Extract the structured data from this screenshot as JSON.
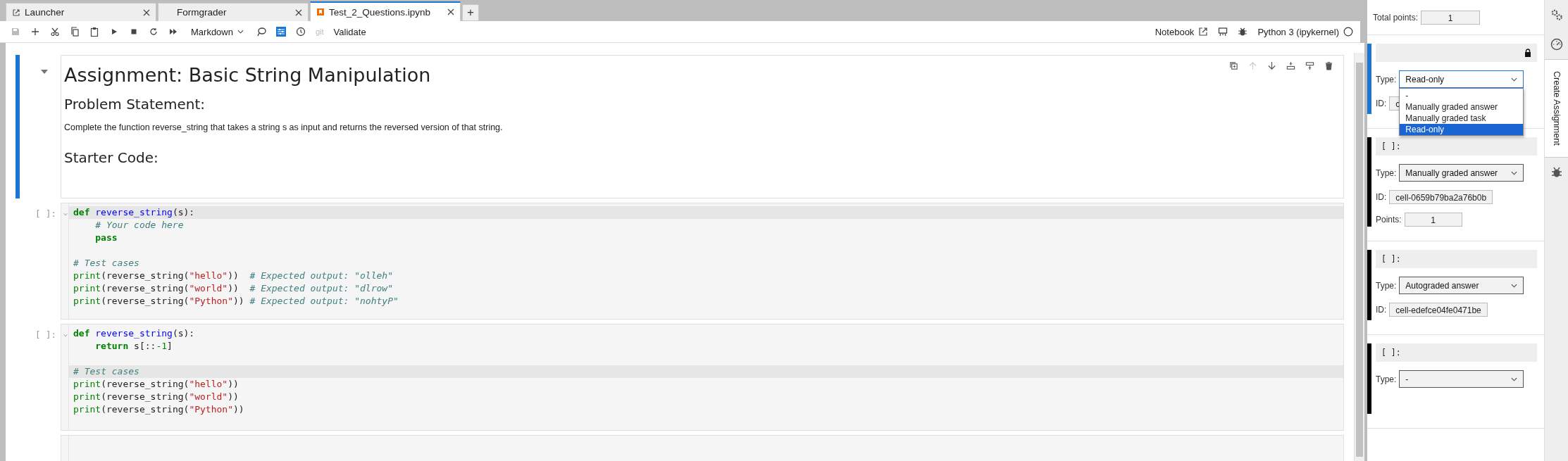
{
  "tabs": [
    {
      "label": "Launcher",
      "kind": "launcher",
      "selected": false
    },
    {
      "label": "Formgrader",
      "kind": "plain",
      "selected": false
    },
    {
      "label": "Test_2_Questions.ipynb",
      "kind": "notebook",
      "selected": true
    }
  ],
  "add_tab": "+",
  "toolbar": {
    "cell_type": "Markdown",
    "git": "git",
    "validate": "Validate",
    "notebook_link": "Notebook",
    "kernel": "Python 3 (ipykernel)"
  },
  "cells": [
    {
      "kind": "markdown",
      "selected": true,
      "blocks": [
        {
          "kind": "h1",
          "text": "Assignment: Basic String Manipulation"
        },
        {
          "kind": "h2",
          "text": "Problem Statement:"
        },
        {
          "kind": "p",
          "text": "Complete the function reverse_string that takes a string s as input and returns the reversed version of that string."
        },
        {
          "kind": "h2",
          "text": "Starter Code:"
        }
      ]
    },
    {
      "kind": "code",
      "selected": false,
      "prompt": "[ ]:",
      "lines": [
        {
          "highlighted": true,
          "indented": false,
          "tokens": [
            {
              "kind": "keyword",
              "text": "def"
            },
            {
              "kind": "def",
              "text": "reverse_string"
            },
            {
              "kind": "plain",
              "text": "(s):"
            }
          ]
        },
        {
          "highlighted": false,
          "indented": true,
          "tokens": [
            {
              "kind": "comment",
              "text": "# Your code here"
            }
          ]
        },
        {
          "highlighted": false,
          "indented": true,
          "tokens": [
            {
              "kind": "keyword",
              "text": "pass"
            }
          ]
        },
        {
          "highlighted": false
        },
        {
          "highlighted": false,
          "tokens": [
            {
              "kind": "comment",
              "text": "# Test cases"
            }
          ]
        },
        {
          "highlighted": false,
          "tokens": [
            {
              "kind": "builtin",
              "text": "print"
            },
            {
              "kind": "plain",
              "text": "(reverse_string("
            },
            {
              "kind": "string",
              "text": "\"hello\""
            },
            {
              "kind": "plain",
              "text": "))  "
            },
            {
              "kind": "comment",
              "text": "# Expected output: \"olleh\""
            }
          ]
        },
        {
          "highlighted": false,
          "tokens": [
            {
              "kind": "builtin",
              "text": "print"
            },
            {
              "kind": "plain",
              "text": "(reverse_string("
            },
            {
              "kind": "string",
              "text": "\"world\""
            },
            {
              "kind": "plain",
              "text": "))  "
            },
            {
              "kind": "comment",
              "text": "# Expected output: \"dlrow\""
            }
          ]
        },
        {
          "highlighted": false,
          "tokens": [
            {
              "kind": "builtin",
              "text": "print"
            },
            {
              "kind": "plain",
              "text": "(reverse_string("
            },
            {
              "kind": "string",
              "text": "\"Python\""
            },
            {
              "kind": "plain",
              "text": ")) "
            },
            {
              "kind": "comment",
              "text": "# Expected output: \"nohtyP\""
            }
          ]
        }
      ]
    },
    {
      "kind": "code",
      "selected": false,
      "prompt": "[ ]:",
      "lines": [
        {
          "highlighted": false,
          "indented": false,
          "tokens": [
            {
              "kind": "keyword",
              "text": "def"
            },
            {
              "kind": "def",
              "text": "reverse_string"
            },
            {
              "kind": "plain",
              "text": "(s):"
            }
          ]
        },
        {
          "highlighted": false,
          "indented": true,
          "tokens": [
            {
              "kind": "keyword",
              "text": "return"
            },
            {
              "kind": "plain",
              "text": " s[::"
            },
            {
              "kind": "number",
              "text": "-1"
            },
            {
              "kind": "plain",
              "text": "]"
            }
          ]
        },
        {
          "highlighted": false
        },
        {
          "highlighted": true,
          "tokens": [
            {
              "kind": "comment",
              "text": "# Test cases"
            }
          ]
        },
        {
          "highlighted": false,
          "tokens": [
            {
              "kind": "builtin",
              "text": "print"
            },
            {
              "kind": "plain",
              "text": "(reverse_string("
            },
            {
              "kind": "string",
              "text": "\"hello\""
            },
            {
              "kind": "plain",
              "text": "))"
            }
          ]
        },
        {
          "highlighted": false,
          "tokens": [
            {
              "kind": "builtin",
              "text": "print"
            },
            {
              "kind": "plain",
              "text": "(reverse_string("
            },
            {
              "kind": "string",
              "text": "\"world\""
            },
            {
              "kind": "plain",
              "text": "))"
            }
          ]
        },
        {
          "highlighted": false,
          "tokens": [
            {
              "kind": "builtin",
              "text": "print"
            },
            {
              "kind": "plain",
              "text": "(reverse_string("
            },
            {
              "kind": "string",
              "text": "\"Python\""
            },
            {
              "kind": "plain",
              "text": "))"
            }
          ]
        }
      ]
    },
    {
      "kind": "code",
      "selected": false
    }
  ],
  "panel": {
    "total_label": "Total points:",
    "total": "1",
    "cells": [
      {
        "selected": true,
        "locked": true,
        "type_label": "Type:",
        "type": "Read-only",
        "open": true,
        "options": [
          {
            "label": "-",
            "selected": false
          },
          {
            "label": "Manually graded answer",
            "selected": false
          },
          {
            "label": "Manually graded task",
            "selected": false
          },
          {
            "label": "Read-only",
            "selected": true
          }
        ],
        "id_label": "ID:",
        "id": "c"
      },
      {
        "selected": false,
        "locked": false,
        "prompt": "[ ]:",
        "type_label": "Type:",
        "type": "Manually graded answer",
        "open": false,
        "id_label": "ID:",
        "id": "cell-0659b79ba2a76b0b",
        "points_label": "Points:",
        "points": "1"
      },
      {
        "selected": false,
        "locked": false,
        "prompt": "[ ]:",
        "type_label": "Type:",
        "type": "Autograded answer",
        "open": false,
        "id_label": "ID:",
        "id": "cell-edefce04fe0471be"
      },
      {
        "selected": false,
        "locked": false,
        "prompt": "[ ]:",
        "type_label": "Type:",
        "type": "-",
        "open": false
      }
    ]
  },
  "side_tabs": [
    {
      "kind": "gear",
      "selected": false
    },
    {
      "kind": "gauge",
      "selected": false
    },
    {
      "kind": "text",
      "label": "Create Assignment",
      "selected": true
    },
    {
      "kind": "bug",
      "selected": false
    }
  ]
}
